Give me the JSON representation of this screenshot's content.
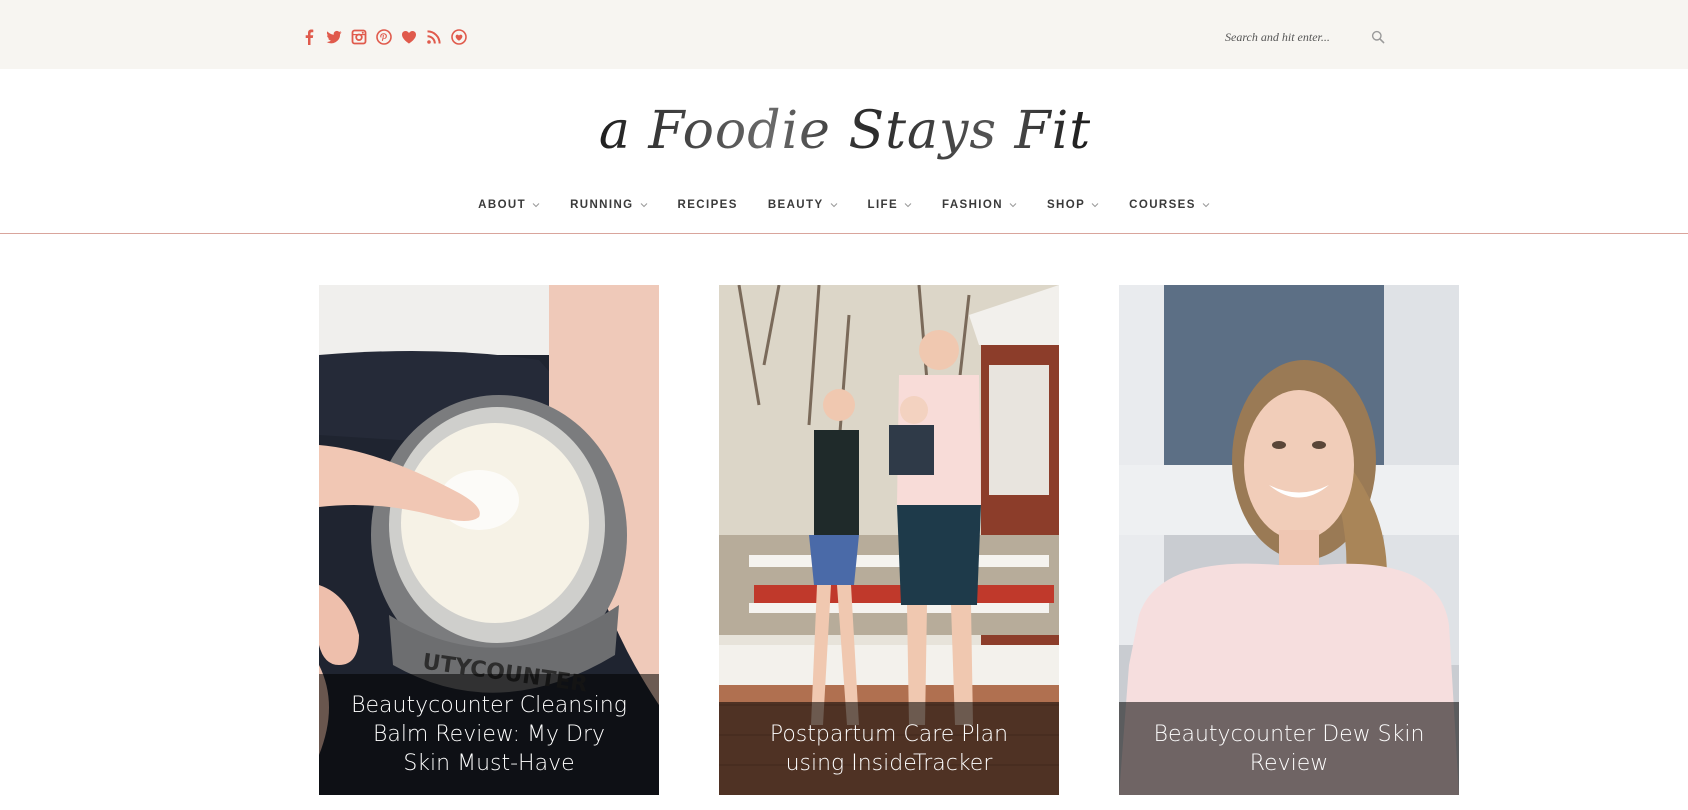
{
  "colors": {
    "topbar_bg": "#f7f5f1",
    "social_icon": "#e05a4c",
    "nav_underline": "#d9a59c",
    "caption_overlay": "rgba(0,0,0,0.55)"
  },
  "social": [
    {
      "icon": "facebook-icon"
    },
    {
      "icon": "twitter-icon"
    },
    {
      "icon": "instagram-icon"
    },
    {
      "icon": "pinterest-icon"
    },
    {
      "icon": "heart-icon"
    },
    {
      "icon": "rss-icon"
    },
    {
      "icon": "bloglovin-icon"
    }
  ],
  "search": {
    "placeholder": "Search and hit enter..."
  },
  "logo": {
    "text": "a Foodie Stays Fit"
  },
  "nav": [
    {
      "label": "ABOUT",
      "dropdown": true
    },
    {
      "label": "RUNNING",
      "dropdown": true
    },
    {
      "label": "RECIPES",
      "dropdown": false
    },
    {
      "label": "BEAUTY",
      "dropdown": true
    },
    {
      "label": "LIFE",
      "dropdown": true
    },
    {
      "label": "FASHION",
      "dropdown": true
    },
    {
      "label": "SHOP",
      "dropdown": true
    },
    {
      "label": "COURSES",
      "dropdown": true
    }
  ],
  "posts": [
    {
      "title": "Beautycounter Cleansing Balm Review: My Dry Skin Must-Have",
      "jar_text": "UTYCOUNTER"
    },
    {
      "title": "Postpartum Care Plan using InsideTracker"
    },
    {
      "title": "Beautycounter Dew Skin Review"
    }
  ]
}
